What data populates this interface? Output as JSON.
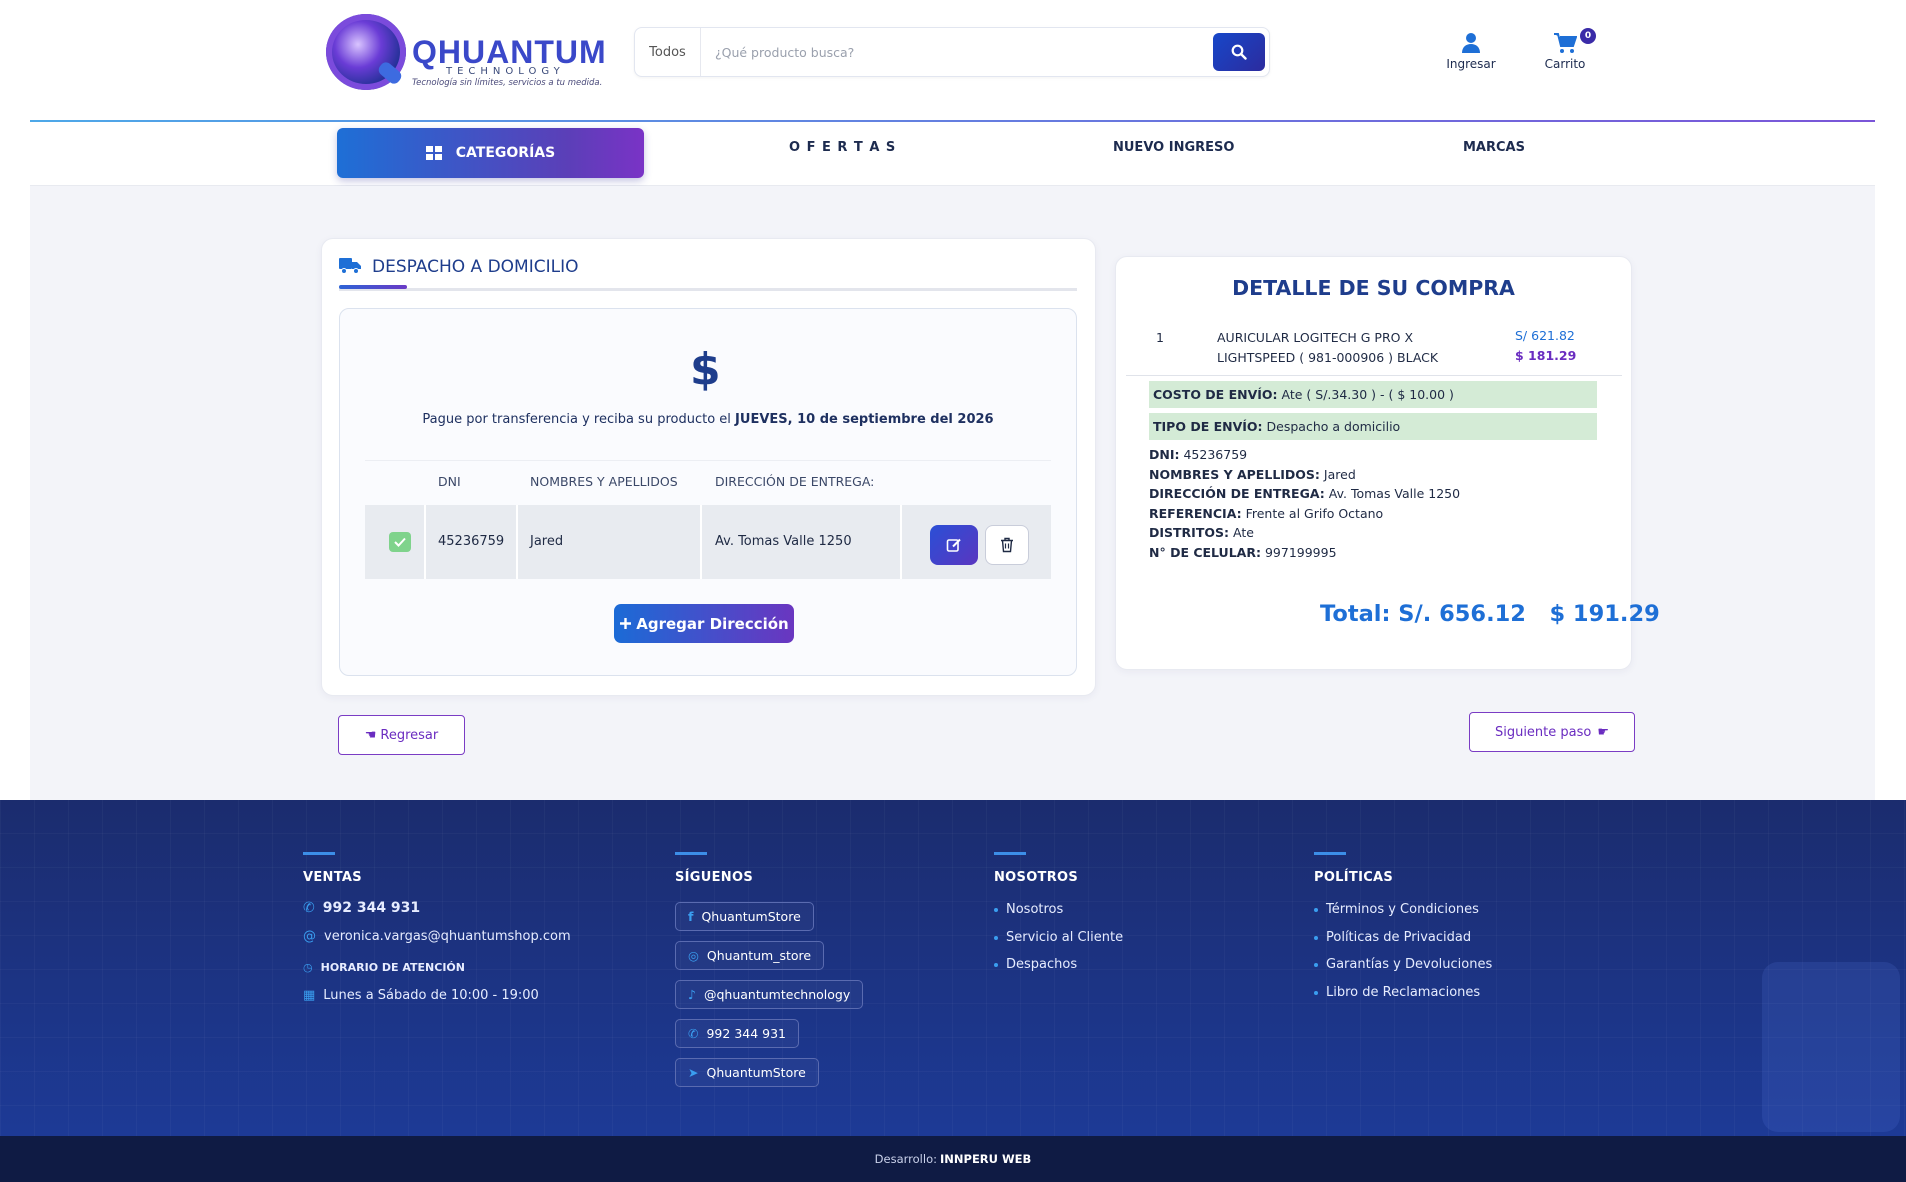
{
  "header": {
    "logo": {
      "name": "QHUANTUM",
      "sub": "TECHNOLOGY",
      "tagline": "Tecnología sin límites, servicios a tu medida."
    },
    "search": {
      "category": "Todos",
      "placeholder": "¿Qué producto busca?"
    },
    "login_label": "Ingresar",
    "cart_label": "Carrito",
    "cart_count": "0"
  },
  "nav": {
    "categories": "CATEGORÍAS",
    "offers": "O F E R T A S",
    "new": "NUEVO INGRESO",
    "brands": "MARCAS"
  },
  "shipping": {
    "title": "DESPACHO A DOMICILIO",
    "dollar": "$",
    "pay_text": "Pague por transferencia y reciba su producto el ",
    "pay_date": "JUEVES, 10 de septiembre del 2026",
    "table": {
      "headers": [
        "DNI",
        "NOMBRES Y APELLIDOS",
        "DIRECCIÓN DE ENTREGA:"
      ],
      "row": {
        "dni": "45236759",
        "name": "Jared",
        "address": "Av. Tomas Valle 1250"
      }
    },
    "add_button": "Agregar Dirección"
  },
  "detail": {
    "title": "DETALLE DE SU COMPRA",
    "item": {
      "qty": "1",
      "name_line1": "AURICULAR LOGITECH G PRO X",
      "name_line2": "LIGHTSPEED ( 981-000906 ) BLACK",
      "price_pen": "S/ 621.82",
      "price_usd": "$ 181.29"
    },
    "shipping_cost_label": "COSTO DE ENVÍO:",
    "shipping_cost_value": "Ate ( S/.34.30 ) - ( $ 10.00 )",
    "shipping_type_label": "TIPO DE ENVÍO:",
    "shipping_type_value": "Despacho a domicilio",
    "info": [
      {
        "label": "DNI:",
        "value": "45236759"
      },
      {
        "label": "NOMBRES Y APELLIDOS:",
        "value": "Jared"
      },
      {
        "label": "DIRECCIÓN DE ENTREGA:",
        "value": "Av. Tomas Valle 1250"
      },
      {
        "label": "REFERENCIA:",
        "value": "Frente al Grifo Octano"
      },
      {
        "label": "DISTRITOS:",
        "value": "Ate"
      },
      {
        "label": "N° DE CELULAR:",
        "value": "997199995"
      }
    ],
    "total": "Total: S/. 656.12",
    "total_usd": "$ 191.29"
  },
  "actions": {
    "back": "Regresar",
    "next": "Siguiente paso"
  },
  "footer": {
    "sales": {
      "title": "VENTAS",
      "phone": "992 344 931",
      "email": "veronica.vargas@qhuantumshop.com",
      "hours_title": "HORARIO DE ATENCIÓN",
      "hours": "Lunes a Sábado de 10:00 - 19:00"
    },
    "follow": {
      "title": "SÍGUENOS",
      "items": [
        "QhuantumStore",
        "Qhuantum_store",
        "@qhuantumtechnology",
        "992 344 931",
        "QhuantumStore"
      ]
    },
    "about": {
      "title": "NOSOTROS",
      "items": [
        "Nosotros",
        "Servicio al Cliente",
        "Despachos"
      ]
    },
    "policies": {
      "title": "POLÍTICAS",
      "items": [
        "Términos y Condiciones",
        "Políticas de Privacidad",
        "Garantías y Devoluciones",
        "Libro de Reclamaciones"
      ]
    },
    "credit_prefix": "Desarrollo:",
    "credit_name": "INNPERU WEB"
  },
  "colors": {
    "primary": "#1e3d8c",
    "accent": "#6a2cc0",
    "blue": "#1e6fd6",
    "footer": "#1a2d72"
  }
}
